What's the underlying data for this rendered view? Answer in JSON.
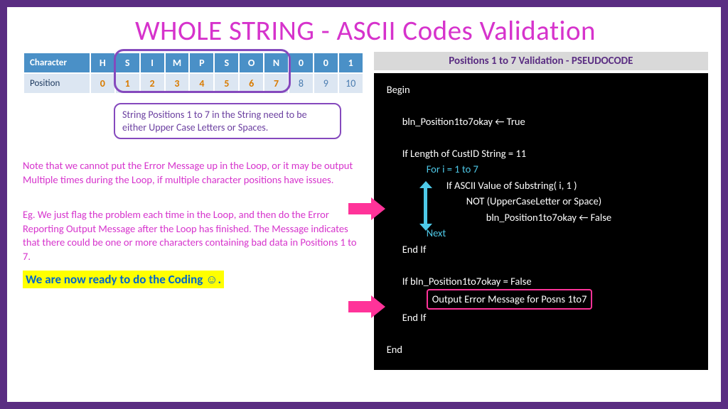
{
  "title": "WHOLE STRING - ASCII Codes Validation",
  "table": {
    "char_label": "Character",
    "pos_label": "Position",
    "chars": [
      "H",
      "S",
      "I",
      "M",
      "P",
      "S",
      "O",
      "N",
      "0",
      "0",
      "1"
    ],
    "positions": [
      "0",
      "1",
      "2",
      "3",
      "4",
      "5",
      "6",
      "7",
      "8",
      "9",
      "10"
    ]
  },
  "note_box": "String Positions 1 to 7 in the String need to be either Upper Case Letters or Spaces.",
  "para1": "Note that we cannot put the Error Message up in the Loop, or it may be output Multiple times during the Loop, if multiple character positions have issues.",
  "para2": "Eg. We just flag the problem each time in the Loop, and then do the Error Reporting Output Message after the Loop has finished. The Message indicates that there could be one or more characters containing bad data in Positions 1 to 7.",
  "ready": "We are now ready to do the Coding ☺.",
  "pseudo_title": "Positions 1 to 7 Validation - PSEUDOCODE",
  "code": {
    "l0": "Begin",
    "l1": "bln_Position1to7okay ← True",
    "l2": "If  Length of CustID String = 11",
    "l3": "For i = 1 to 7",
    "l4": "If ASCII Value of Substring( i, 1 )",
    "l5": "NOT (UpperCaseLetter  or Space)",
    "l6": "bln_Position1to7okay ← False",
    "l7": "Next",
    "l8": "End If",
    "l9": "If  bln_Position1to7okay = False",
    "l10": "Output Error Message for Posns 1to7",
    "l11": "End If",
    "l12": "End"
  }
}
